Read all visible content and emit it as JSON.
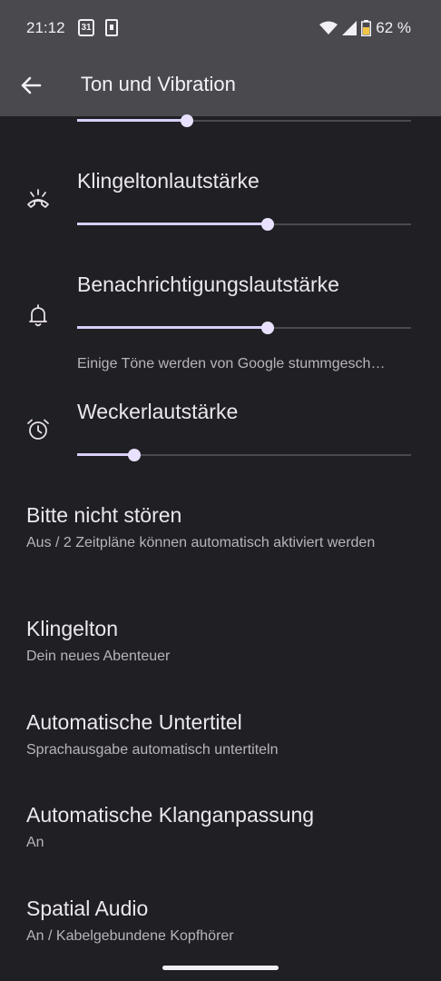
{
  "status": {
    "time": "21:12",
    "calendar_day": "31",
    "battery": "62 %"
  },
  "header": {
    "title": "Ton und Vibration"
  },
  "volumes": [
    {
      "label": "",
      "level": 0.33
    },
    {
      "label": "Klingeltonlautstärke",
      "level": 0.57
    },
    {
      "label": "Benachrichtigungslautstärke",
      "level": 0.57
    },
    {
      "label": "Weckerlautstärke",
      "level": 0.17
    }
  ],
  "notification_note": "Einige Töne werden von Google stummgesch…",
  "items": [
    {
      "title": "Bitte nicht stören",
      "subtitle": "Aus / 2 Zeitpläne können automatisch aktiviert werden"
    },
    {
      "title": "Klingelton",
      "subtitle": "Dein neues Abenteuer"
    },
    {
      "title": "Automatische Untertitel",
      "subtitle": "Sprachausgabe automatisch untertiteln"
    },
    {
      "title": "Automatische Klanganpassung",
      "subtitle": "An"
    },
    {
      "title": "Spatial Audio",
      "subtitle": "An / Kabelgebundene Kopfhörer"
    }
  ],
  "icons": {
    "back": "arrow-back-icon",
    "ring": "ring-volume-icon",
    "notification": "bell-icon",
    "alarm": "alarm-clock-icon"
  },
  "colors": {
    "accent": "#d8cffa",
    "background": "#201f23",
    "appbar": "#4a494e"
  }
}
